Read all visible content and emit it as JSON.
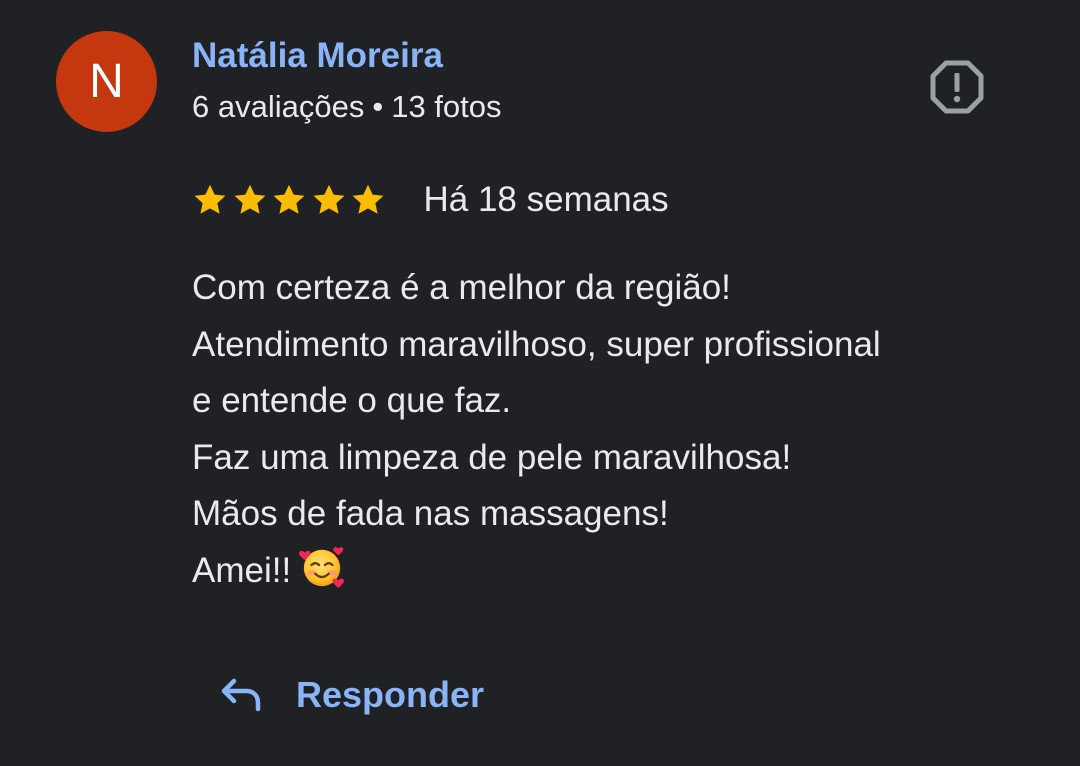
{
  "review": {
    "author": {
      "initial": "N",
      "name": "Natália Moreira",
      "reviews_count": "6 avaliações",
      "separator": "•",
      "photos_count": "13 fotos",
      "avatar_color": "#c5380f"
    },
    "rating": {
      "stars": 5,
      "max": 5,
      "star_color": "#fbbc04"
    },
    "date": "Há 18 semanas",
    "text_lines": [
      "Com certeza é a melhor da região!",
      "Atendimento maravilhoso, super profissional",
      "e entende o que faz.",
      "Faz uma limpeza de pele maravilhosa!",
      "Mãos de fada nas massagens!",
      "Amei!!"
    ],
    "emoji": "smiling-face-with-hearts-icon"
  },
  "actions": {
    "report_icon": "report-icon",
    "reply_icon": "reply-arrow-icon",
    "reply_label": "Responder"
  },
  "colors": {
    "background": "#202124",
    "link": "#8ab4f8",
    "text": "#e8eaed",
    "icon_gray": "#9aa0a6"
  }
}
